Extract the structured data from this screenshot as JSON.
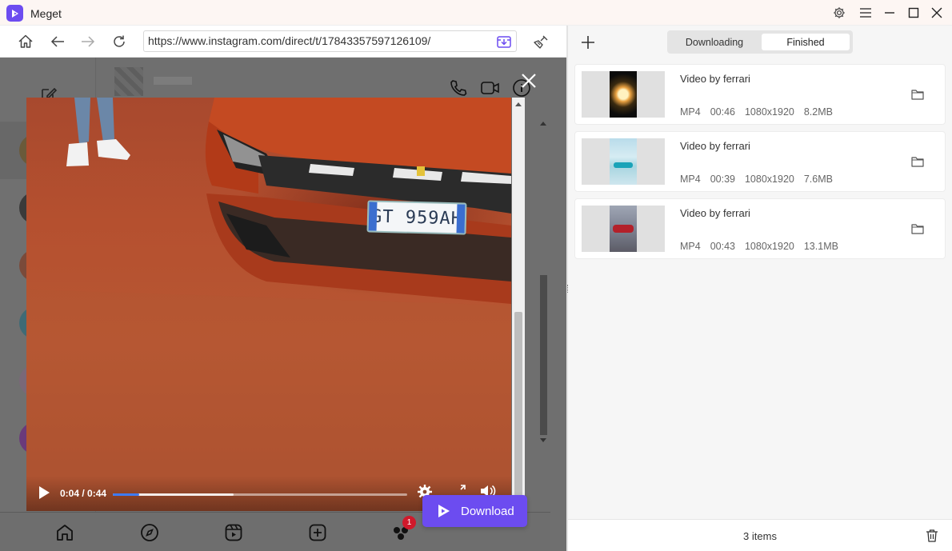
{
  "app": {
    "title": "Meget"
  },
  "navbar": {
    "url": "https://www.instagram.com/direct/t/17843357597126109/"
  },
  "video": {
    "plate_text": "GT 959AH",
    "time": "0:04 / 0:44",
    "progress_fraction": 0.091,
    "buffered_fraction": 0.41
  },
  "overlay": {
    "download_label": "Download"
  },
  "instagram": {
    "notification_count": "1"
  },
  "right": {
    "tabs": {
      "downloading": "Downloading",
      "finished": "Finished",
      "active": "finished"
    },
    "items": [
      {
        "title": "Video by ferrari",
        "format": "MP4",
        "duration": "00:46",
        "resolution": "1080x1920",
        "size": "8.2MB"
      },
      {
        "title": "Video by ferrari",
        "format": "MP4",
        "duration": "00:39",
        "resolution": "1080x1920",
        "size": "7.6MB"
      },
      {
        "title": "Video by ferrari",
        "format": "MP4",
        "duration": "00:43",
        "resolution": "1080x1920",
        "size": "13.1MB"
      }
    ],
    "footer_count": "3 items"
  },
  "colors": {
    "brand": "#6c4cf0",
    "seek": "#3d7bf7",
    "badge": "#d0192b"
  }
}
